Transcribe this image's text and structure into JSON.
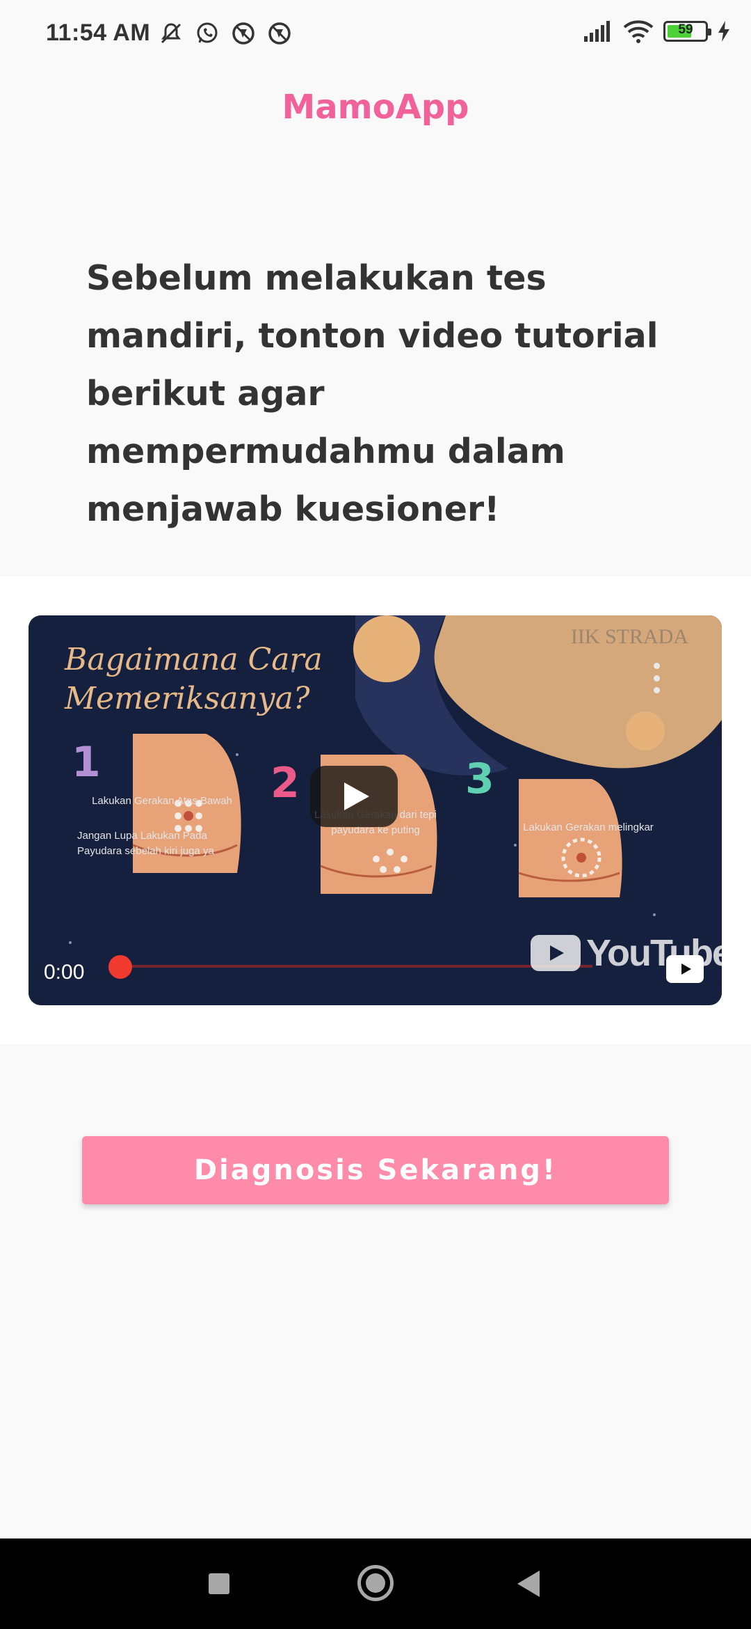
{
  "status_bar": {
    "time": "11:54 AM",
    "battery_level": "59",
    "left_icons": [
      "mute-notification-icon",
      "whatsapp-icon",
      "location-off-icon",
      "location-off-icon"
    ],
    "right_icons": [
      "signal-icon",
      "wifi-icon",
      "battery-icon",
      "charging-icon"
    ]
  },
  "app": {
    "title": "MamoApp",
    "accent_color": "#f2629a"
  },
  "intro": {
    "text": "Sebelum melakukan tes mandiri, tonton video tutorial berikut agar mempermudahmu dalam menjawab kuesioner!"
  },
  "video": {
    "heading_line1": "Bagaimana Cara",
    "heading_line2": "Memeriksanya?",
    "channel": "IIK STRADA",
    "steps": [
      {
        "number": "1",
        "caption": "Lakukan Gerakan Atas Bawah"
      },
      {
        "number": "2",
        "caption": "Lakukan Gerakan dari tepi payudara ke puting"
      },
      {
        "number": "3",
        "caption": "Lakukan Gerakan melingkar"
      }
    ],
    "reminder_line1": "Jangan Lupa Lakukan Pada",
    "reminder_line2": "Payudara sebelah kiri juga ya",
    "current_time": "0:00",
    "progress": 0,
    "brand": "YouTube"
  },
  "action": {
    "diagnose_label": "Diagnosis Sekarang!",
    "button_color": "#ff8bab"
  },
  "nav": {
    "icons": [
      "recent-apps-icon",
      "home-icon",
      "back-icon"
    ]
  }
}
